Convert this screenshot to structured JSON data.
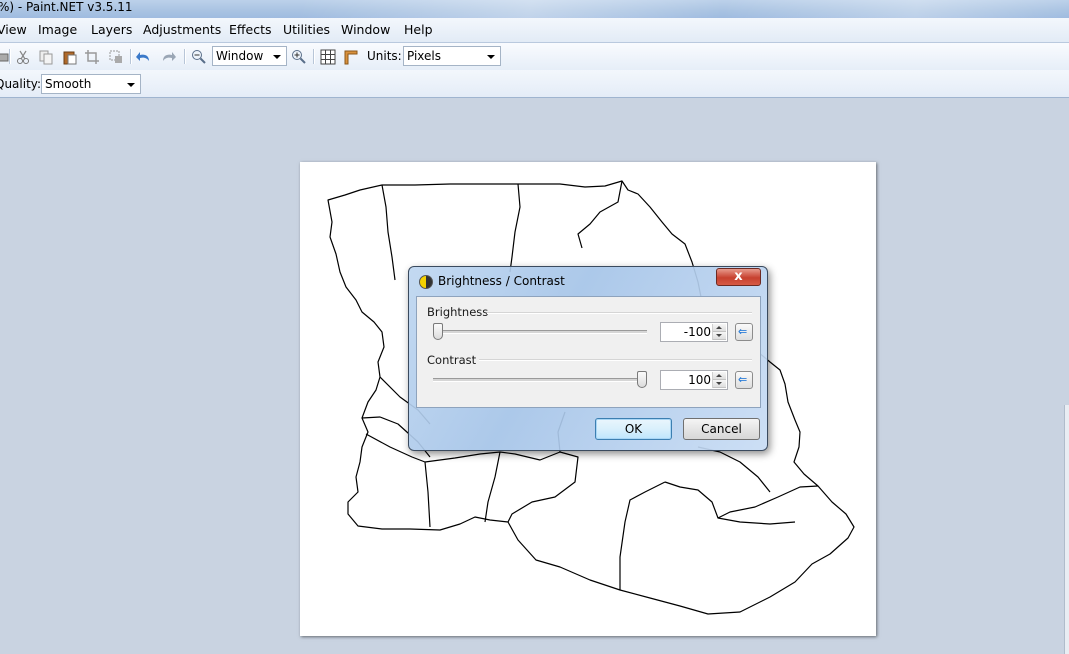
{
  "window": {
    "title": "%) - Paint.NET v3.5.11"
  },
  "menu": {
    "items": [
      "View",
      "Image",
      "Layers",
      "Adjustments",
      "Effects",
      "Utilities",
      "Window",
      "Help"
    ]
  },
  "toolbar": {
    "zoom_value": "Window",
    "units_label": "Units:",
    "units_value": "Pixels",
    "quality_label": "Quality:",
    "quality_value": "Smooth"
  },
  "dialog": {
    "title": "Brightness / Contrast",
    "close_glyph": "x",
    "brightness": {
      "label": "Brightness",
      "value": "-100",
      "level": 0.0
    },
    "contrast": {
      "label": "Contrast",
      "value": "100",
      "level": 1.0
    },
    "ok_label": "OK",
    "cancel_label": "Cancel"
  }
}
